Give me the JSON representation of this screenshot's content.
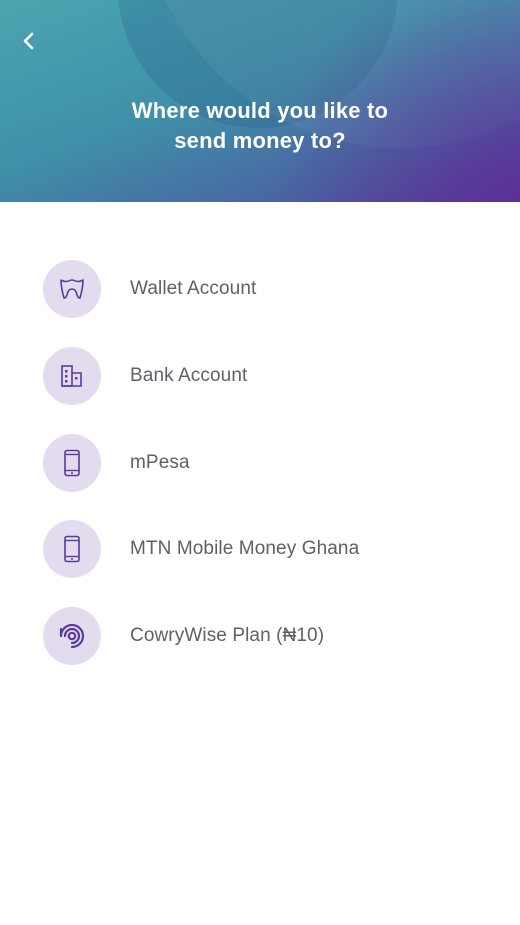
{
  "header": {
    "title_line1": "Where would you like to",
    "title_line2": "send money to?",
    "back_icon": "chevron-left-icon"
  },
  "options": [
    {
      "label": "Wallet Account",
      "icon": "wallet-icon"
    },
    {
      "label": "Bank Account",
      "icon": "bank-building-icon"
    },
    {
      "label": "mPesa",
      "icon": "mobile-phone-icon"
    },
    {
      "label": "MTN Mobile Money Ghana",
      "icon": "mobile-phone-icon"
    },
    {
      "label": "CowryWise Plan (₦10)",
      "icon": "cowrywise-icon"
    }
  ],
  "colors": {
    "header_teal": "#4aa6b0",
    "header_purple": "#5a3a98",
    "icon_bg": "#e3dcef",
    "icon_stroke": "#5b3a9e",
    "label_text": "#5f6068"
  }
}
